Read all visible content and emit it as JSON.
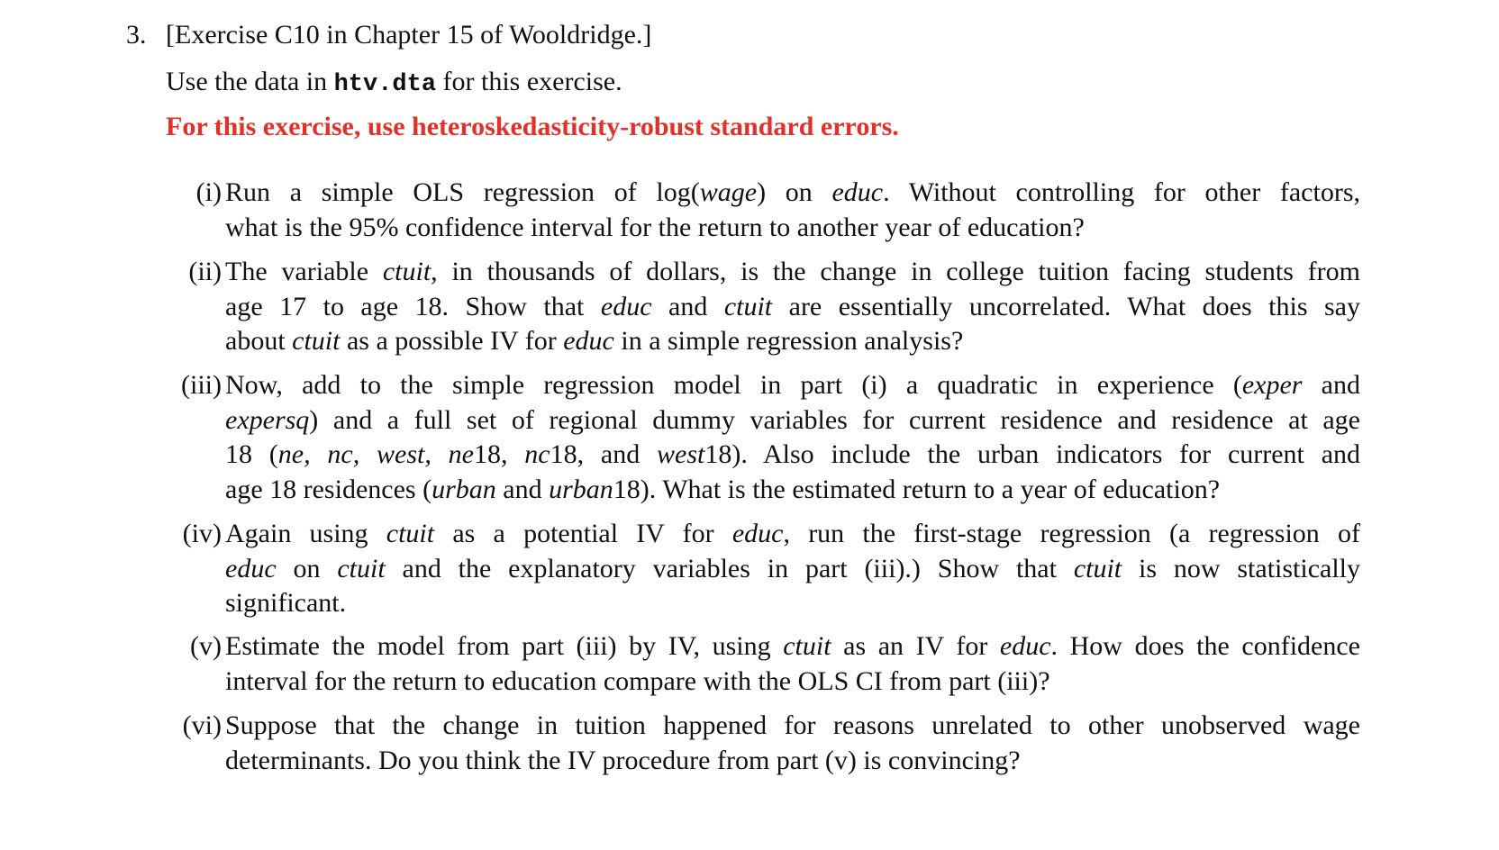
{
  "document": {
    "number": "3.",
    "header": "[Exercise C10 in Chapter 15 of Wooldridge.]",
    "intro_before": "Use the data in ",
    "intro_file": "htv.dta",
    "intro_after": " for this exercise.",
    "notice": "For this exercise, use heteroskedasticity-robust standard errors.",
    "notice_color": "#E0322A",
    "parts": [
      {
        "label": "(i)",
        "lines": [
          [
            {
              "t": "Run a simple OLS regression of log("
            },
            {
              "t": "wage",
              "i": true
            },
            {
              "t": ") on "
            },
            {
              "t": "educ",
              "i": true
            },
            {
              "t": ". Without controlling for other factors,"
            }
          ],
          [
            {
              "t": "what is the 95% confidence interval for the return to another year of education?"
            }
          ]
        ]
      },
      {
        "label": "(ii)",
        "lines": [
          [
            {
              "t": "The variable "
            },
            {
              "t": "ctuit",
              "i": true
            },
            {
              "t": ", in thousands of dollars, is the change in college tuition facing students from"
            }
          ],
          [
            {
              "t": "age 17 to age 18. Show that "
            },
            {
              "t": "educ",
              "i": true
            },
            {
              "t": " and "
            },
            {
              "t": "ctuit",
              "i": true
            },
            {
              "t": " are essentially uncorrelated. What does this say"
            }
          ],
          [
            {
              "t": "about "
            },
            {
              "t": "ctuit",
              "i": true
            },
            {
              "t": " as a possible IV for "
            },
            {
              "t": "educ",
              "i": true
            },
            {
              "t": " in a simple regression analysis?"
            }
          ]
        ]
      },
      {
        "label": "(iii)",
        "lines": [
          [
            {
              "t": "Now, add to the simple regression model in part (i) a quadratic in experience ("
            },
            {
              "t": "exper",
              "i": true
            },
            {
              "t": " and"
            }
          ],
          [
            {
              "t": "expersq",
              "i": true
            },
            {
              "t": ") and a full set of regional dummy variables for current residence and residence at age"
            }
          ],
          [
            {
              "t": "18 ("
            },
            {
              "t": "ne, nc, west, ne",
              "i": true
            },
            {
              "t": "18, "
            },
            {
              "t": "nc",
              "i": true
            },
            {
              "t": "18, and "
            },
            {
              "t": "west",
              "i": true
            },
            {
              "t": "18). Also include the urban indicators for current and"
            }
          ],
          [
            {
              "t": "age 18 residences ("
            },
            {
              "t": "urban",
              "i": true
            },
            {
              "t": " and "
            },
            {
              "t": "urban",
              "i": true
            },
            {
              "t": "18). What is the estimated return to a year of education?"
            }
          ]
        ]
      },
      {
        "label": "(iv)",
        "lines": [
          [
            {
              "t": "Again using "
            },
            {
              "t": "ctuit",
              "i": true
            },
            {
              "t": " as a potential IV for "
            },
            {
              "t": "educ",
              "i": true
            },
            {
              "t": ", run the first-stage regression (a regression of"
            }
          ],
          [
            {
              "t": "educ",
              "i": true
            },
            {
              "t": " on "
            },
            {
              "t": "ctuit",
              "i": true
            },
            {
              "t": " and the explanatory variables in part (iii).) Show that "
            },
            {
              "t": "ctuit",
              "i": true
            },
            {
              "t": " is now statistically"
            }
          ],
          [
            {
              "t": "significant."
            }
          ]
        ]
      },
      {
        "label": "(v)",
        "lines": [
          [
            {
              "t": "Estimate the model from part (iii) by IV, using "
            },
            {
              "t": "ctuit",
              "i": true
            },
            {
              "t": " as an IV for "
            },
            {
              "t": "educ",
              "i": true
            },
            {
              "t": ". How does the confidence"
            }
          ],
          [
            {
              "t": "interval for the return to education compare with the OLS CI from part (iii)?"
            }
          ]
        ]
      },
      {
        "label": "(vi)",
        "lines": [
          [
            {
              "t": "Suppose that the change in tuition happened for reasons unrelated to other unobserved wage"
            }
          ],
          [
            {
              "t": "determinants. Do you think the IV procedure from part (v) is convincing?"
            }
          ]
        ]
      }
    ]
  }
}
